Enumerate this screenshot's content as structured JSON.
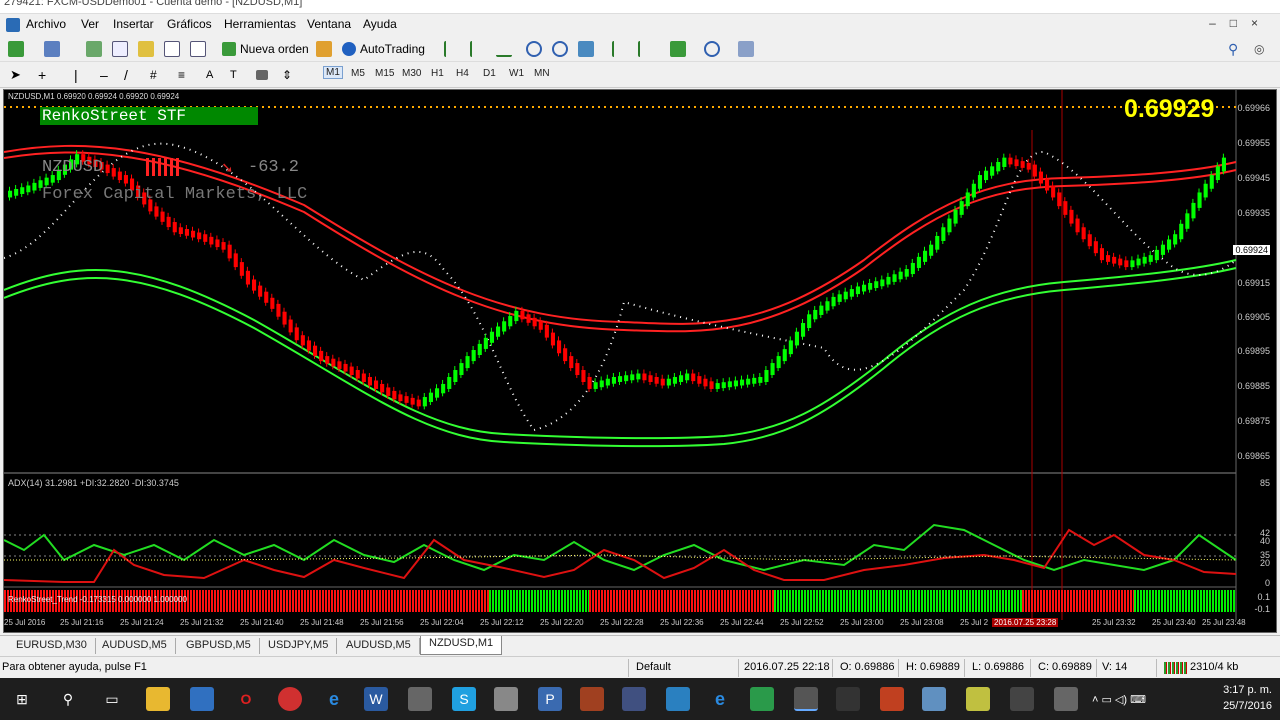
{
  "window": {
    "title": "279421: FXCM-USDDemo01 - Cuenta demo - [NZDUSD,M1]"
  },
  "menu": [
    "Archivo",
    "Ver",
    "Insertar",
    "Gráficos",
    "Herramientas",
    "Ventana",
    "Ayuda"
  ],
  "toolbar": {
    "new_order": "Nueva orden",
    "autotrading": "AutoTrading"
  },
  "timeframes": [
    "M1",
    "M5",
    "M15",
    "M30",
    "H1",
    "H4",
    "D1",
    "W1",
    "MN"
  ],
  "active_timeframe": "M1",
  "chart": {
    "header": "NZDUSD,M1  0.69920 0.69924 0.69920 0.69924",
    "renko_title": "RenkoStreet STF",
    "symbol": "NZDUSD",
    "change": "-63.2",
    "broker": "Forex Capital Markets, LLC",
    "big_price": "0.69929",
    "current_price_tag": "0.69924",
    "price_ticks": [
      "0.69966",
      "0.69955",
      "0.69945",
      "0.69935",
      "0.69924",
      "0.69915",
      "0.69905",
      "0.69895",
      "0.69885",
      "0.69875",
      "0.69865"
    ],
    "adx_header": "ADX(14) 31.2981 +DI:32.2820 -DI:30.3745",
    "adx_ticks": [
      "85",
      "42",
      "40",
      "35",
      "20",
      "0"
    ],
    "trend_label": "RenkoStreet_Trend -0.173315 0.000000 1.000000",
    "trend_ticks": [
      "0.1",
      "-0.1"
    ],
    "time_ticks": [
      "25 Jul 2016",
      "25 Jul 21:16",
      "25 Jul 21:24",
      "25 Jul 21:32",
      "25 Jul 21:40",
      "25 Jul 21:48",
      "25 Jul 21:56",
      "25 Jul 22:04",
      "25 Jul 22:12",
      "25 Jul 22:20",
      "25 Jul 22:28",
      "25 Jul 22:36",
      "25 Jul 22:44",
      "25 Jul 22:52",
      "25 Jul 23:00",
      "25 Jul 23:08",
      "25 Jul 2",
      "2016.07.25 23:28",
      "25 Jul 23:32",
      "25 Jul 23:40",
      "25 Jul 23:48"
    ]
  },
  "tabs": [
    "EURUSD,M30",
    "AUDUSD,M5",
    "GBPUSD,M5",
    "USDJPY,M5",
    "AUDUSD,M5",
    "NZDUSD,M1"
  ],
  "active_tab": "NZDUSD,M1",
  "status": {
    "help": "Para obtener ayuda, pulse F1",
    "profile": "Default",
    "datetime": "2016.07.25 22:18",
    "open": "O: 0.69886",
    "high": "H: 0.69889",
    "low": "L: 0.69886",
    "close": "C: 0.69889",
    "volume": "V: 14",
    "traffic": "2310/4 kb"
  },
  "taskbar": {
    "time": "3:17 p. m.",
    "date": "25/7/2016"
  },
  "colors": {
    "bull": "#00ff00",
    "bear": "#ff0000",
    "green_band": "#33ff33",
    "red_band": "#ff2222",
    "accent_yellow": "#ffff00"
  },
  "chart_data": {
    "type": "candlestick",
    "series": [
      {
        "name": "close",
        "values": [
          0.69942,
          0.69945,
          0.69951,
          0.69948,
          0.69944,
          0.69936,
          0.6993,
          0.69928,
          0.69925,
          0.69915,
          0.69908,
          0.69899,
          0.69893,
          0.6989,
          0.69886,
          0.69882,
          0.6988,
          0.69885,
          0.69893,
          0.699,
          0.69906,
          0.69902,
          0.69893,
          0.69885,
          0.69887,
          0.69888,
          0.69886,
          0.69888,
          0.69885,
          0.69886,
          0.69887,
          0.69895,
          0.69905,
          0.6991,
          0.69913,
          0.69915,
          0.69918,
          0.69925,
          0.69935,
          0.69945,
          0.6995,
          0.69948,
          0.6994,
          0.6993,
          0.69922,
          0.6992,
          0.69922,
          0.69928,
          0.6994,
          0.6995
        ]
      }
    ]
  }
}
